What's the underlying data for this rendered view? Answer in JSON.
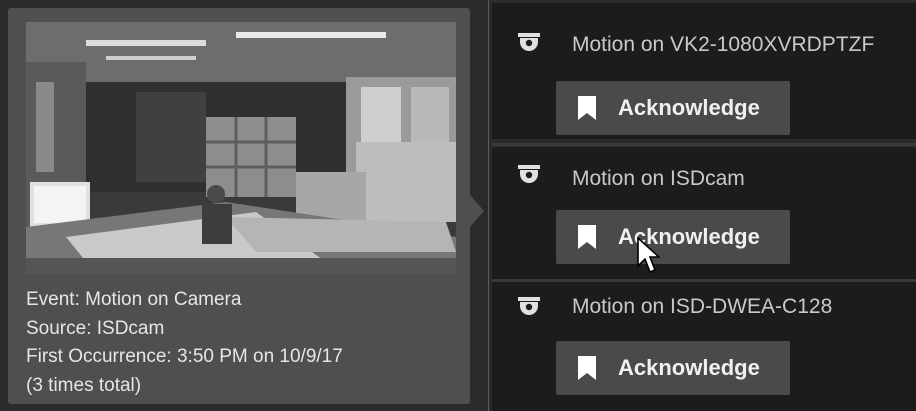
{
  "event": {
    "line1": "Event: Motion on Camera",
    "line2": "Source: ISDcam",
    "line3": "First Occurrence: 3:50 PM on 10/9/17",
    "line4": "(3 times total)"
  },
  "alerts": [
    {
      "title": "Motion on VK2-1080XVRDPTZF",
      "button": "Acknowledge",
      "icon": "dome-camera-icon"
    },
    {
      "title": "Motion on ISDcam",
      "button": "Acknowledge",
      "icon": "dome-camera-icon"
    },
    {
      "title": "Motion on ISD-DWEA-C128",
      "button": "Acknowledge",
      "icon": "dome-camera-icon"
    }
  ],
  "colors": {
    "panel": "#4f4f4f",
    "alert_bg": "#1c1c1c",
    "button_bg": "#4a4a4a"
  }
}
